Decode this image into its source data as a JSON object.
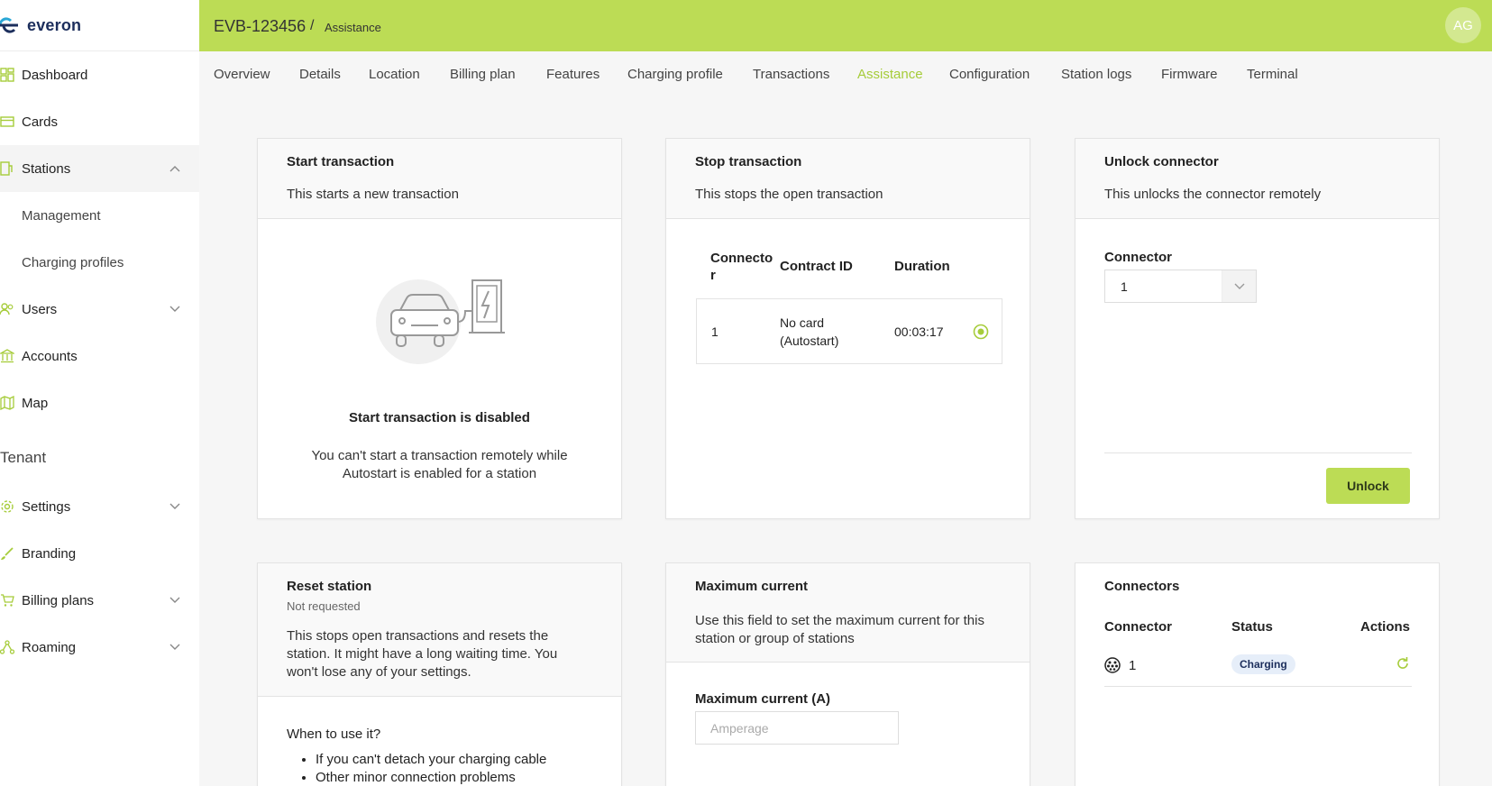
{
  "app": {
    "logo_text": "everon",
    "accent": "#bcdc55"
  },
  "header": {
    "station_id": "EVB-123456",
    "separator": "/",
    "section": "Assistance",
    "avatar_initials": "AG"
  },
  "sidebar": {
    "items": [
      {
        "label": "Dashboard",
        "icon": "dashboard-icon"
      },
      {
        "label": "Cards",
        "icon": "card-icon"
      },
      {
        "label": "Stations",
        "icon": "station-icon"
      },
      {
        "label": "Management"
      },
      {
        "label": "Charging profiles"
      },
      {
        "label": "Users",
        "icon": "users-icon"
      },
      {
        "label": "Accounts",
        "icon": "bank-icon"
      },
      {
        "label": "Map",
        "icon": "map-icon"
      }
    ],
    "section_label": "Tenant",
    "tenant_items": [
      {
        "label": "Settings",
        "icon": "gear-icon"
      },
      {
        "label": "Branding",
        "icon": "brush-icon"
      },
      {
        "label": "Billing plans",
        "icon": "cart-icon"
      },
      {
        "label": "Roaming",
        "icon": "roaming-icon"
      }
    ]
  },
  "tabs": [
    "Overview",
    "Details",
    "Location",
    "Billing plan",
    "Features",
    "Charging profile",
    "Transactions",
    "Assistance",
    "Configuration",
    "Station logs",
    "Firmware",
    "Terminal"
  ],
  "active_tab": "Assistance",
  "start_transaction": {
    "title": "Start transaction",
    "desc": "This starts a new transaction",
    "disabled_title": "Start transaction is disabled",
    "disabled_line1": "You can't start a transaction remotely while",
    "disabled_line2": "Autostart is enabled for a station"
  },
  "stop_transaction": {
    "title": "Stop transaction",
    "desc": "This stops the open transaction",
    "col_connector_1": "Connecto",
    "col_connector_2": "r",
    "col_contract": "Contract ID",
    "col_duration": "Duration",
    "row": {
      "connector": "1",
      "contract_1": "No card",
      "contract_2": "(Autostart)",
      "duration": "00:03:17"
    }
  },
  "unlock_connector": {
    "title": "Unlock connector",
    "desc": "This unlocks the connector remotely",
    "field_label": "Connector",
    "selected": "1",
    "button": "Unlock"
  },
  "reset_station": {
    "title": "Reset station",
    "status": "Not requested",
    "desc_1": "This stops open transactions and resets the",
    "desc_2": "station. It might have a long waiting time. You",
    "desc_3": "won't lose any of your settings.",
    "when_label": "When to use it?",
    "bullets": [
      "If you can't detach your charging cable",
      "Other minor connection problems"
    ]
  },
  "max_current": {
    "title": "Maximum current",
    "desc_1": "Use this field to set the maximum current for this",
    "desc_2": "station or group of stations",
    "field_label": "Maximum current (A)",
    "placeholder": "Amperage"
  },
  "connectors": {
    "title": "Connectors",
    "col_connector": "Connector",
    "col_status": "Status",
    "col_actions": "Actions",
    "row": {
      "connector": "1",
      "status": "Charging"
    }
  }
}
